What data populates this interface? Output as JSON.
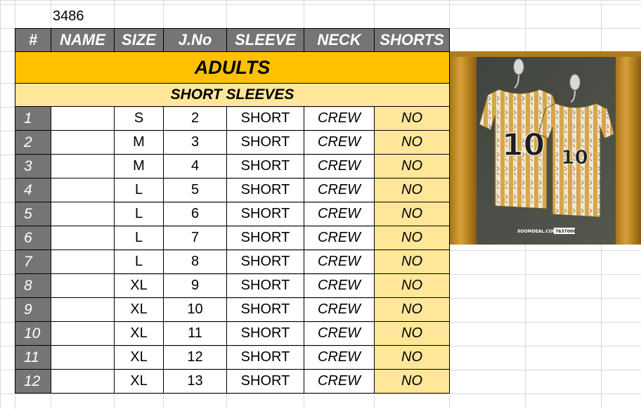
{
  "order_number": "3486",
  "headers": [
    "#",
    "NAME",
    "SIZE",
    "J.No",
    "SLEEVE",
    "NECK",
    "SHORTS"
  ],
  "section_title": "ADULTS",
  "subsection_title": "SHORT SLEEVES",
  "rows": [
    {
      "n": "1",
      "name": "",
      "size": "S",
      "jno": "2",
      "sleeve": "SHORT",
      "neck": "CREW",
      "shorts": "NO"
    },
    {
      "n": "2",
      "name": "",
      "size": "M",
      "jno": "3",
      "sleeve": "SHORT",
      "neck": "CREW",
      "shorts": "NO"
    },
    {
      "n": "3",
      "name": "",
      "size": "M",
      "jno": "4",
      "sleeve": "SHORT",
      "neck": "CREW",
      "shorts": "NO"
    },
    {
      "n": "4",
      "name": "",
      "size": "L",
      "jno": "5",
      "sleeve": "SHORT",
      "neck": "CREW",
      "shorts": "NO"
    },
    {
      "n": "5",
      "name": "",
      "size": "L",
      "jno": "6",
      "sleeve": "SHORT",
      "neck": "CREW",
      "shorts": "NO"
    },
    {
      "n": "6",
      "name": "",
      "size": "L",
      "jno": "7",
      "sleeve": "SHORT",
      "neck": "CREW",
      "shorts": "NO"
    },
    {
      "n": "7",
      "name": "",
      "size": "L",
      "jno": "8",
      "sleeve": "SHORT",
      "neck": "CREW",
      "shorts": "NO"
    },
    {
      "n": "8",
      "name": "",
      "size": "XL",
      "jno": "9",
      "sleeve": "SHORT",
      "neck": "CREW",
      "shorts": "NO"
    },
    {
      "n": "9",
      "name": "",
      "size": "XL",
      "jno": "10",
      "sleeve": "SHORT",
      "neck": "CREW",
      "shorts": "NO"
    },
    {
      "n": "10",
      "name": "",
      "size": "XL",
      "jno": "11",
      "sleeve": "SHORT",
      "neck": "CREW",
      "shorts": "NO"
    },
    {
      "n": "11",
      "name": "",
      "size": "XL",
      "jno": "12",
      "sleeve": "SHORT",
      "neck": "CREW",
      "shorts": "NO"
    },
    {
      "n": "12",
      "name": "",
      "size": "XL",
      "jno": "13",
      "sleeve": "SHORT",
      "neck": "CREW",
      "shorts": "NO"
    }
  ],
  "jersey_photo": {
    "jersey_number": "10",
    "watermark": "XOOMDEAL.COM",
    "code": "7637000"
  },
  "colors": {
    "header_bg": "#757575",
    "adults_band": "#ffc000",
    "light_band": "#ffe699",
    "gridline": "#d9d9d9"
  }
}
